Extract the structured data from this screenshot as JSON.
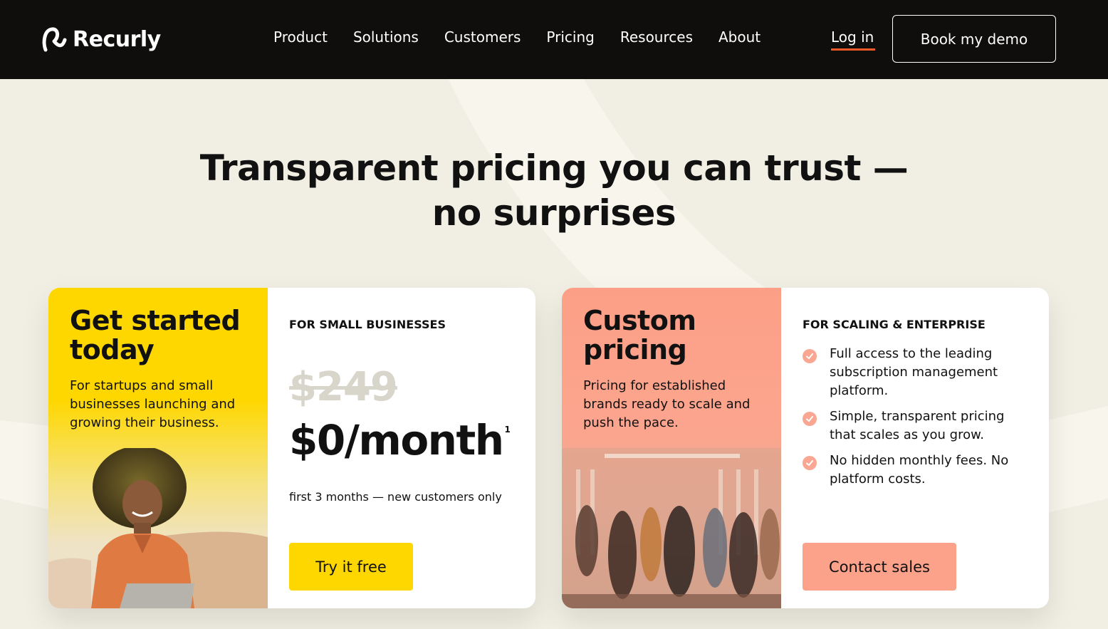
{
  "nav": {
    "brand": "Recurly",
    "links": [
      "Product",
      "Solutions",
      "Customers",
      "Pricing",
      "Resources",
      "About"
    ],
    "login": "Log in",
    "demo_button": "Book my demo"
  },
  "hero": {
    "title_line1": "Transparent pricing you can trust —",
    "title_line2": "no surprises"
  },
  "card_small": {
    "heading_line1": "Get started",
    "heading_line2": "today",
    "description": "For startups and small businesses launching and growing their business.",
    "label": "FOR SMALL BUSINESSES",
    "old_price": "$249",
    "new_price": "$0/month",
    "footnote": "1",
    "note": "first 3 months — new customers only",
    "cta": "Try it free"
  },
  "card_enterprise": {
    "heading_line1": "Custom",
    "heading_line2": "pricing",
    "description": "Pricing for established brands ready to scale and push the pace.",
    "label": "FOR SCALING & ENTERPRISE",
    "features": [
      "Full access to the leading subscription management platform.",
      "Simple, transparent pricing that scales as you grow.",
      "No hidden monthly fees. No platform costs."
    ],
    "cta": "Contact sales"
  },
  "colors": {
    "nav_bg": "#0f0e0c",
    "page_bg": "#f1efe3",
    "yellow": "#fed700",
    "salmon": "#fca28b",
    "login_underline": "#f05a28"
  }
}
